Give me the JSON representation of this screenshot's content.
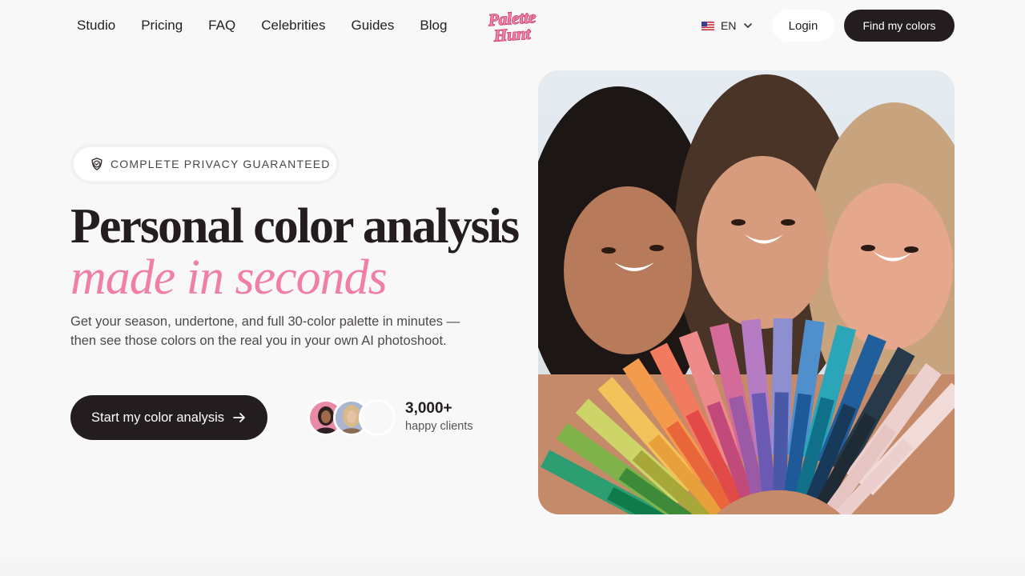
{
  "nav": {
    "links": [
      "Studio",
      "Pricing",
      "FAQ",
      "Celebrities",
      "Guides",
      "Blog"
    ],
    "logo_text_line1": "Palette",
    "logo_text_line2": "Hunt",
    "language": "EN",
    "login_label": "Login",
    "cta_label": "Find my colors"
  },
  "hero": {
    "badge": "COMPLETE PRIVACY GUARANTEED",
    "title_line1": "Personal color analysis",
    "title_line2": "made in seconds",
    "subtitle": "Get your season, undertone, and full 30-color palette in minutes — then see those colors on the real you in your own AI photoshoot.",
    "cta_label": "Start my color analysis",
    "clients_count": "3,000+",
    "clients_label": "happy clients"
  },
  "colors": {
    "accent_pink": "#f07ea6",
    "dark": "#231d20",
    "background": "#f8f8f8"
  },
  "icons": {
    "badge": "shield-check-icon",
    "cta": "arrow-right-icon",
    "language_toggle": "chevron-down-icon",
    "flag": "us-flag-icon"
  }
}
